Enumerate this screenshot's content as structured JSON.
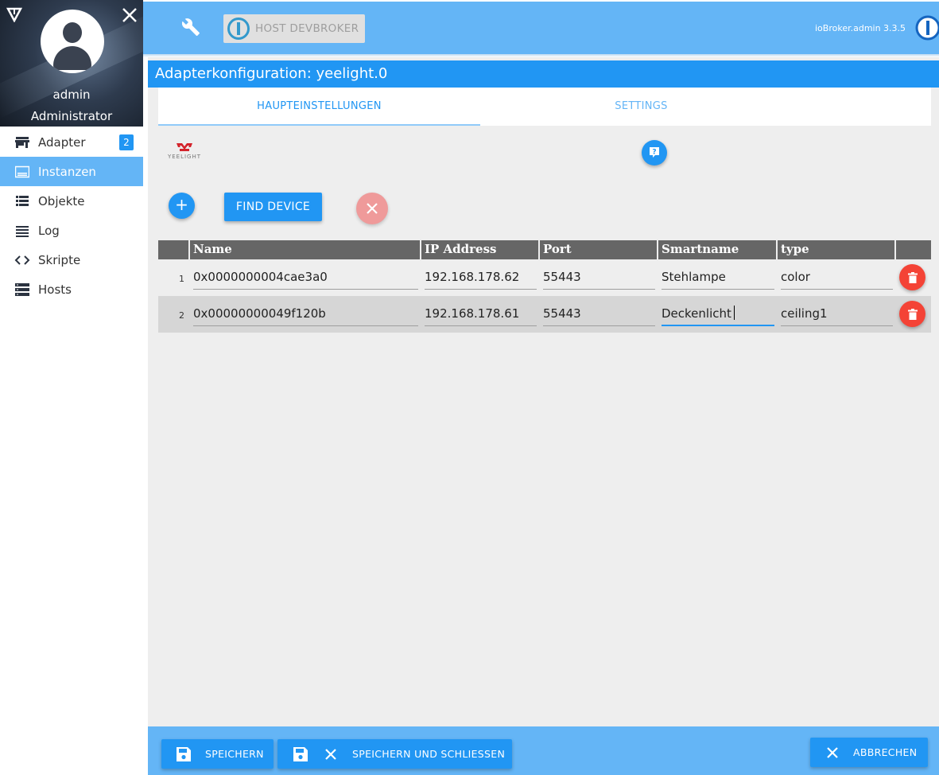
{
  "sidebar": {
    "user_name": "admin",
    "user_role": "Administrator",
    "items": [
      {
        "label": "Adapter",
        "icon": "store-icon",
        "badge": "2"
      },
      {
        "label": "Instanzen",
        "icon": "instances-icon"
      },
      {
        "label": "Objekte",
        "icon": "list-icon"
      },
      {
        "label": "Log",
        "icon": "menu-lines-icon"
      },
      {
        "label": "Skripte",
        "icon": "code-icon"
      },
      {
        "label": "Hosts",
        "icon": "server-icon"
      }
    ]
  },
  "header": {
    "host_label": "HOST DEVBROKER",
    "version": "ioBroker.admin 3.3.5"
  },
  "config": {
    "title": "Adapterkonfiguration: yeelight.0",
    "tabs": [
      "HAUPTEINSTELLUNGEN",
      "SETTINGS"
    ],
    "logo_text": "YEELIGHT",
    "find_device_label": "FIND DEVICE"
  },
  "table": {
    "columns": [
      "Name",
      "IP Address",
      "Port",
      "Smartname",
      "type"
    ],
    "rows": [
      {
        "num": "1",
        "name": "0x0000000004cae3a0",
        "ip": "192.168.178.62",
        "port": "55443",
        "smartname": "Stehlampe",
        "type": "color"
      },
      {
        "num": "2",
        "name": "0x00000000049f120b",
        "ip": "192.168.178.61",
        "port": "55443",
        "smartname": "Deckenlicht",
        "type": "ceiling1"
      }
    ]
  },
  "footer": {
    "save_label": "SPEICHERN",
    "save_close_label": "SPEICHERN UND SCHLIESSEN",
    "cancel_label": "ABBRECHEN"
  },
  "colors": {
    "primary": "#2196f3",
    "light_primary": "#64b5f6",
    "delete": "#f44336"
  }
}
